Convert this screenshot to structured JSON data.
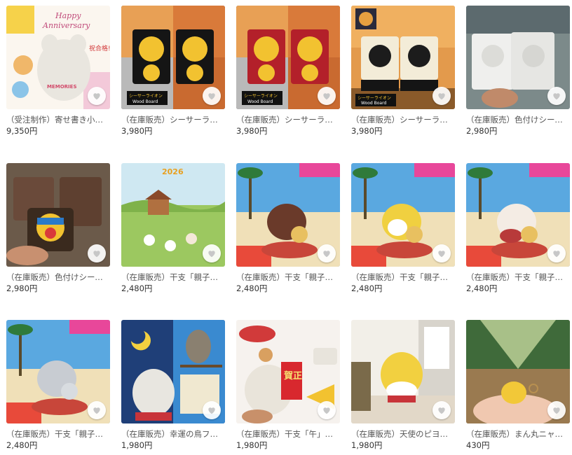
{
  "products": [
    {
      "title": "（受注制作）寄せ書き小槌ニ…",
      "price": "9,350円",
      "art_text": [
        "Happy",
        "Anniversary",
        "祝合格!",
        "MEMORIES"
      ]
    },
    {
      "title": "（在庫販売）シーサーライオ…",
      "price": "3,980円",
      "art_text": [
        "シーサーライオン",
        "Wood Board"
      ]
    },
    {
      "title": "（在庫販売）シーサーライオ…",
      "price": "3,980円",
      "art_text": [
        "シーサーライオン",
        "Wood Board"
      ]
    },
    {
      "title": "（在庫販売）シーサーライオ…",
      "price": "3,980円",
      "art_text": [
        "シーサーライオン",
        "Wood Board"
      ]
    },
    {
      "title": "（在庫販売）色付けシーサー…",
      "price": "2,980円"
    },
    {
      "title": "（在庫販売）色付けシーサー…",
      "price": "2,980円"
    },
    {
      "title": "（在庫販売）干支「親子午ホ…",
      "price": "2,480円",
      "art_text": [
        "2026"
      ]
    },
    {
      "title": "（在庫販売）干支「親子午ダ…",
      "price": "2,480円"
    },
    {
      "title": "（在庫販売）干支「親子午黄…",
      "price": "2,480円"
    },
    {
      "title": "（在庫販売）干支「親子午ブ…",
      "price": "2,480円"
    },
    {
      "title": "（在庫販売）干支「親子午シ…",
      "price": "2,480円"
    },
    {
      "title": "（在庫販売）幸運の鳥フクロ…",
      "price": "1,980円"
    },
    {
      "title": "（在庫販売）干支「午」！樹…",
      "price": "1,980円",
      "art_text": [
        "賀正"
      ]
    },
    {
      "title": "（在庫販売）天使のピヨコし…",
      "price": "1,980円"
    },
    {
      "title": "（在庫販売）まん丸ニャンズ…",
      "price": "430円"
    }
  ],
  "icons": {
    "favorite": "heart-icon"
  },
  "colors": {
    "heart": "#c7c7c7",
    "title": "#555555",
    "price": "#333333"
  }
}
